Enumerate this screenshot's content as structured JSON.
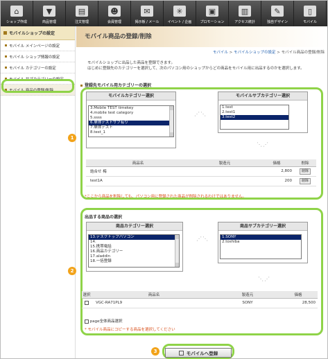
{
  "toolbar": [
    {
      "label": "ショップ作成",
      "icon": "house-icon",
      "glyph": "⌂"
    },
    {
      "label": "商品管理",
      "icon": "shirt-icon",
      "glyph": "▼"
    },
    {
      "label": "注文管理",
      "icon": "document-icon",
      "glyph": "▤"
    },
    {
      "label": "会員管理",
      "icon": "members-icon",
      "glyph": "☻"
    },
    {
      "label": "掲示板 / メール",
      "icon": "mail-icon",
      "glyph": "✉"
    },
    {
      "label": "イベント / 企画",
      "icon": "fireworks-icon",
      "glyph": "✳"
    },
    {
      "label": "プロモーション",
      "icon": "promotion-icon",
      "glyph": "▣"
    },
    {
      "label": "アクセス統計",
      "icon": "stats-icon",
      "glyph": "▥"
    },
    {
      "label": "独自デザイン",
      "icon": "design-icon",
      "glyph": "✎"
    },
    {
      "label": "モバイル",
      "icon": "mobile-icon",
      "glyph": "▯"
    }
  ],
  "sidebar": {
    "title": "モバイルショップの設定",
    "items": [
      "モバイル メインページの設定",
      "モバイル ショップ情報の設定",
      "モバイル カテゴリーの設定",
      "モバイル サブカテゴリーの設定",
      "モバイル 商品の登録/削除"
    ]
  },
  "main": {
    "title": "モバイル商品の登録/削除",
    "breadcrumb": {
      "link1": "モバイル",
      "sep1": " > ",
      "link2": "モバイルショップの設定",
      "sep2": " > ",
      "current": "モバイル商品の登録/削除"
    },
    "intro_1": "モバイルショップに出品した商品を登録できます。",
    "intro_2": "はじめに登録先のカテゴリーを選択して、次のパソコン用のショップからどの商品をモバイル用に出品するのかを選択します。"
  },
  "section1": {
    "title": "登録先モバイル用カテゴリーの選択",
    "cat_header": "モバイルカテゴリー選択",
    "subcat_header": "モバイルサブカテゴリー選択",
    "categories": [
      "3.Mobile TEST timekey",
      "4.mobile test category",
      "5.ssss",
      "6.単体テストサブ有り",
      "7.単体テスト",
      "8.test_1"
    ],
    "categories_selected": 3,
    "subcategories": [
      "1.test",
      "2.test1",
      "3.test2"
    ],
    "subcategories_selected": 2,
    "table_headers": [
      "商品名",
      "製造元",
      "価格",
      "削除"
    ],
    "rows": [
      {
        "name": "詰合せ 梅",
        "maker": "",
        "price": "2,800",
        "del": "削除"
      },
      {
        "name": "test1A",
        "maker": "",
        "price": "200",
        "del": "削除"
      }
    ],
    "note": "*ここから商品を削除しても、パソコン用に登録された商品が削除されるわけではありません。"
  },
  "section2": {
    "title": "出品する商品の選択",
    "cat_header": "商品カテゴリー選択",
    "subcat_header": "商品サブカテゴリー選択",
    "categories": [
      "13.デスクトップパソコン",
      "14.",
      "15.携帯電話",
      "16.商品カテゴリー",
      "17.aladdin",
      "18.一括登録"
    ],
    "categories_selected": 0,
    "subcategories": [
      "1.SONY",
      "2.toshiba"
    ],
    "subcategories_selected": 0,
    "table_headers": [
      "選択",
      "商品名",
      "製造元",
      "価格"
    ],
    "rows": [
      {
        "name": "VGC-RA71PL9",
        "maker": "SONY",
        "price": "28,500"
      }
    ],
    "select_all": "page全体商品選択",
    "note": "* モバイル商品にコピーする商品を選択してください"
  },
  "register_button": "モバイルへ登録",
  "badges": [
    "1",
    "2",
    "3"
  ],
  "colors": {
    "callout": "#8fd348",
    "badge": "#f2a31a",
    "selection": "#0a246a"
  }
}
